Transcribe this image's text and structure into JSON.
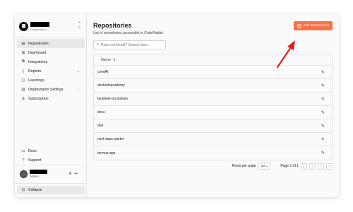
{
  "org": {
    "subtitle": "Organization"
  },
  "nav": {
    "items": [
      {
        "label": "Repositories",
        "icon": "repo-icon"
      },
      {
        "label": "Dashboard",
        "icon": "dashboard-icon"
      },
      {
        "label": "Integrations",
        "icon": "puzzle-icon"
      },
      {
        "label": "Reports",
        "icon": "report-icon"
      },
      {
        "label": "Learnings",
        "icon": "book-icon"
      },
      {
        "label": "Organization Settings",
        "icon": "building-icon"
      },
      {
        "label": "Subscription",
        "icon": "dollar-icon"
      }
    ],
    "bottom": [
      {
        "label": "Docs",
        "icon": "docs-icon"
      },
      {
        "label": "Support",
        "icon": "help-icon"
      }
    ]
  },
  "user": {
    "role": "Admin"
  },
  "collapse": {
    "label": "Collapse"
  },
  "main": {
    "title": "Repositories",
    "subtitle": "List of repositories accessible to CodeRabbit.",
    "add_button": "Add Repositories",
    "search_placeholder": "Repo not found? Search here..."
  },
  "table": {
    "header": "Name",
    "rows": [
      "crewAI",
      "devtoolsacademy",
      "facetime-on-stream",
      "docs",
      "dub",
      "next-saas-starter",
      "termux-app"
    ]
  },
  "pagination": {
    "rows_label": "Rows per page",
    "rows_value": "10",
    "page_info": "Page 1 of 1"
  },
  "colors": {
    "accent": "#f7734a",
    "annotation_arrow": "#e11d1d"
  }
}
